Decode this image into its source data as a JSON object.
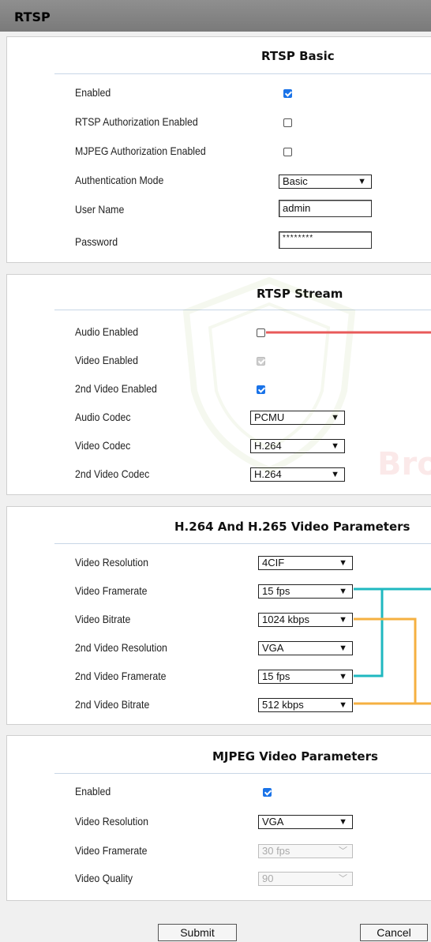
{
  "title": "RTSP",
  "basic": {
    "title": "RTSP Basic",
    "enabled_label": "Enabled",
    "enabled": true,
    "auth_label": "RTSP Authorization Enabled",
    "auth": false,
    "mjpeg_auth_label": "MJPEG Authorization Enabled",
    "mjpeg_auth": false,
    "auth_mode_label": "Authentication Mode",
    "auth_mode": "Basic",
    "username_label": "User Name",
    "username": "admin",
    "password_label": "Password",
    "password": "********"
  },
  "stream": {
    "title": "RTSP Stream",
    "audio_enabled_label": "Audio Enabled",
    "audio_enabled": false,
    "video_enabled_label": "Video Enabled",
    "video_enabled": true,
    "video2_enabled_label": "2nd Video Enabled",
    "video2_enabled": true,
    "audio_codec_label": "Audio Codec",
    "audio_codec": "PCMU",
    "video_codec_label": "Video Codec",
    "video_codec": "H.264",
    "video2_codec_label": "2nd Video Codec",
    "video2_codec": "H.264"
  },
  "h264": {
    "title": "H.264 And H.265 Video Parameters",
    "resolution_label": "Video Resolution",
    "resolution": "4CIF",
    "framerate_label": "Video Framerate",
    "framerate": "15 fps",
    "bitrate_label": "Video Bitrate",
    "bitrate": "1024 kbps",
    "resolution2_label": "2nd Video Resolution",
    "resolution2": "VGA",
    "framerate2_label": "2nd Video Framerate",
    "framerate2": "15 fps",
    "bitrate2_label": "2nd Video Bitrate",
    "bitrate2": "512 kbps"
  },
  "mjpeg": {
    "title": "MJPEG Video Parameters",
    "enabled_label": "Enabled",
    "enabled": true,
    "resolution_label": "Video Resolution",
    "resolution": "VGA",
    "framerate_label": "Video Framerate",
    "framerate": "30 fps",
    "quality_label": "Video Quality",
    "quality": "90"
  },
  "actions": {
    "submit": "Submit",
    "cancel": "Cancel"
  },
  "watermark_text": "Bro",
  "colors": {
    "accent": "#1a73e8",
    "annot_red": "#e85a5a",
    "annot_teal": "#1fb8c0",
    "annot_orange": "#f5b041"
  }
}
